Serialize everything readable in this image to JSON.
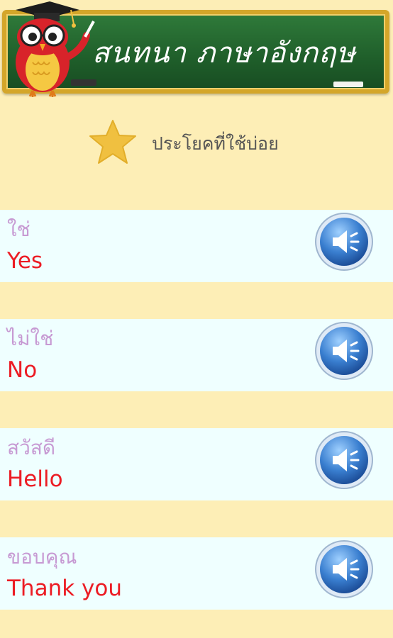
{
  "header": {
    "title": "สนทนา ภาษาอังกฤษ"
  },
  "section": {
    "label": "ประโยคที่ใช้บ่อย",
    "icon": "star-icon"
  },
  "phrases": [
    {
      "thai": "ใช่",
      "english": "Yes"
    },
    {
      "thai": "ไม่ใช่",
      "english": "No"
    },
    {
      "thai": "สวัสดี",
      "english": "Hello"
    },
    {
      "thai": "ขอบคุณ",
      "english": "Thank you"
    }
  ],
  "colors": {
    "background": "#fdeeb6",
    "row": "#efffff",
    "thai_text": "#c79ad3",
    "english_text": "#ec1c24",
    "board": "#1f5e2a",
    "star": "#f0c040",
    "speaker": "#3a7fd0"
  }
}
